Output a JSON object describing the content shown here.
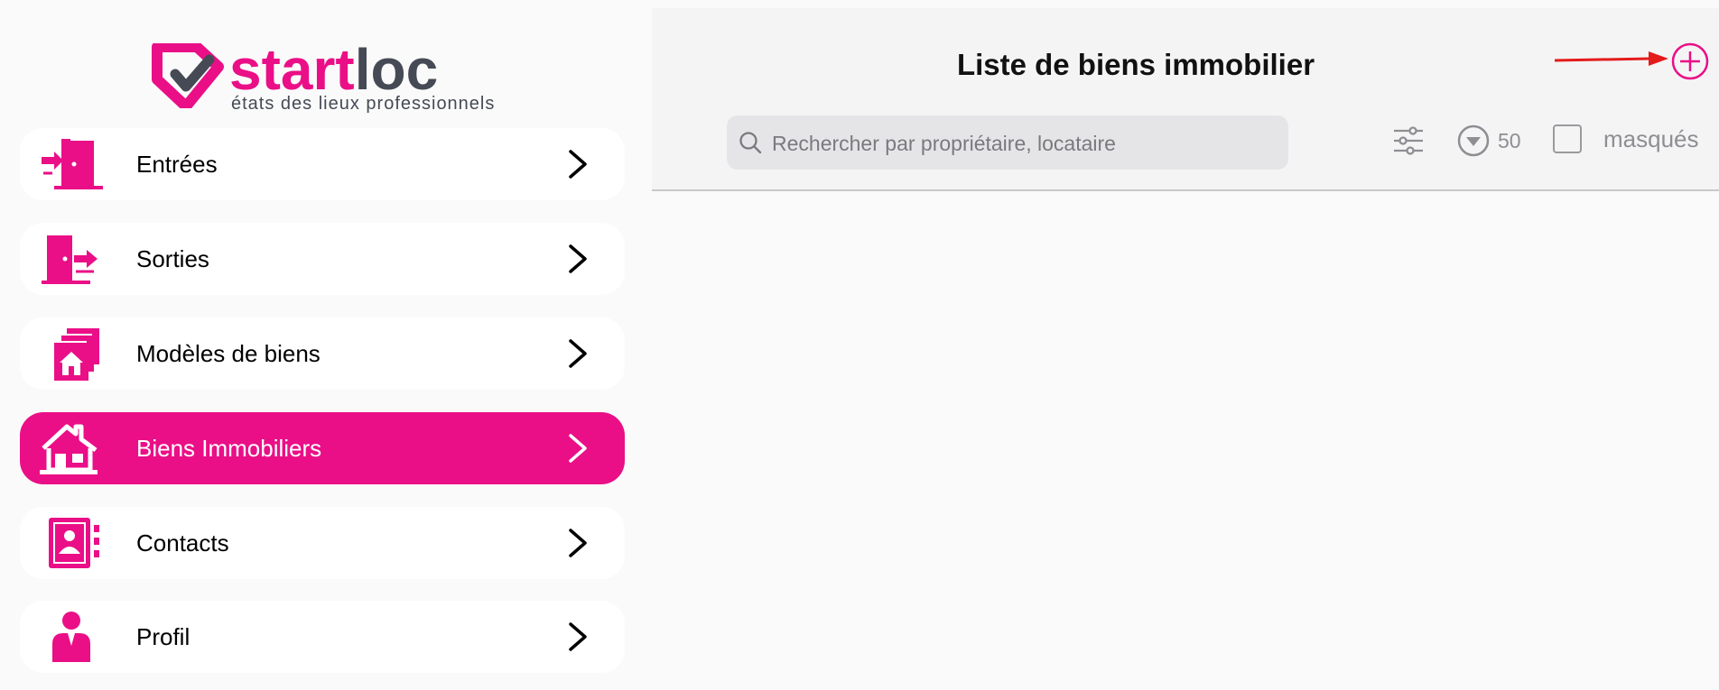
{
  "logo": {
    "part1": "start",
    "part2": "loc",
    "tagline": "états des lieux professionnels"
  },
  "sidebar": {
    "items": [
      {
        "label": "Entrées",
        "icon": "door-enter-icon",
        "active": false
      },
      {
        "label": "Sorties",
        "icon": "door-exit-icon",
        "active": false
      },
      {
        "label": "Modèles de biens",
        "icon": "property-templates-icon",
        "active": false
      },
      {
        "label": "Biens Immobiliers",
        "icon": "house-icon",
        "active": true
      },
      {
        "label": "Contacts",
        "icon": "contacts-book-icon",
        "active": false
      },
      {
        "label": "Profil",
        "icon": "user-icon",
        "active": false
      }
    ]
  },
  "main": {
    "title": "Liste de biens immobilier",
    "search": {
      "placeholder": "Rechercher par propriétaire, locataire",
      "value": ""
    },
    "count": "50",
    "masques_label": "masqués"
  },
  "colors": {
    "accent": "#ea0f87",
    "dark": "#454a55",
    "annotation": "#e41b1b"
  }
}
